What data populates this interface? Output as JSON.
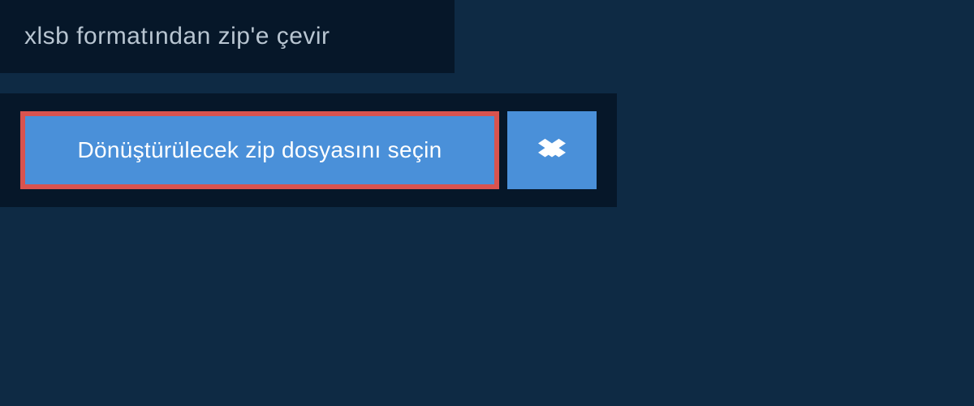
{
  "header": {
    "title": "xlsb formatından zip'e çevir"
  },
  "upload": {
    "select_file_label": "Dönüştürülecek zip dosyasını seçin"
  },
  "colors": {
    "page_bg": "#0e2a44",
    "panel_bg": "#061729",
    "button_bg": "#4a90d9",
    "highlight_border": "#d9534f"
  }
}
